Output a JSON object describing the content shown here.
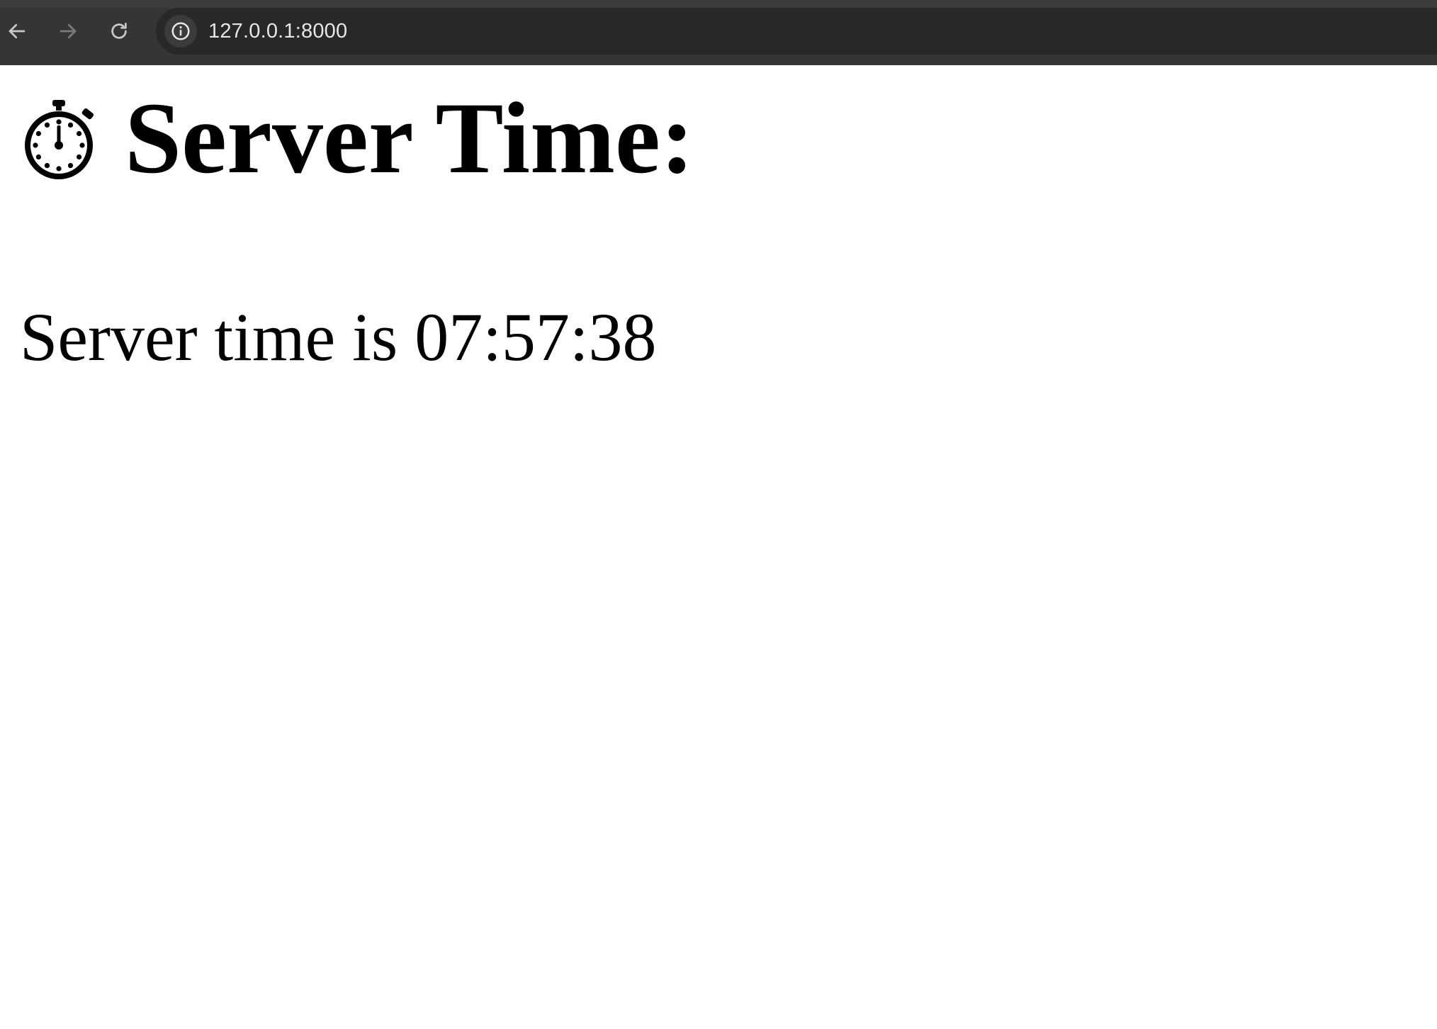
{
  "browser": {
    "url": "127.0.0.1:8000",
    "icons": {
      "back": "arrow-left-icon",
      "forward": "arrow-right-icon",
      "reload": "reload-icon",
      "site_info": "info-icon"
    }
  },
  "page": {
    "heading": "Server Time:",
    "heading_icon": "stopwatch-icon",
    "time_text": "Server time is 07:57:38"
  }
}
